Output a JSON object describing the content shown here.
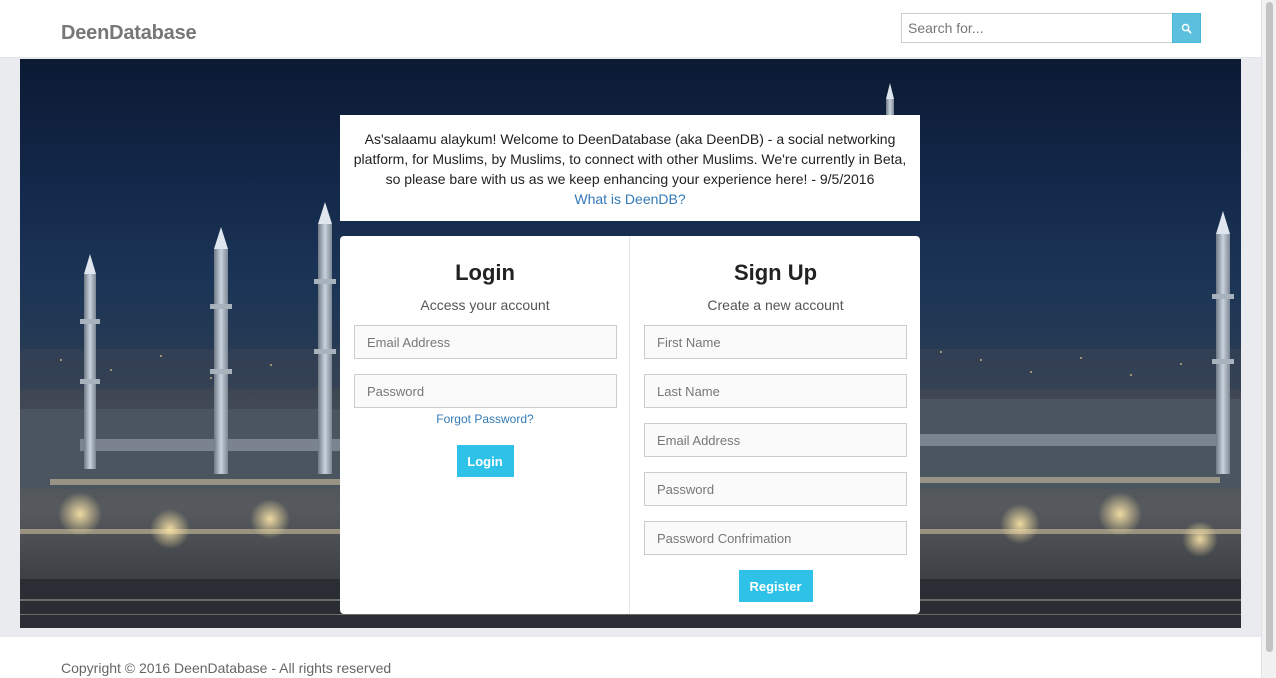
{
  "navbar": {
    "brand": "DeenDatabase",
    "search": {
      "placeholder": "Search for..."
    }
  },
  "welcome": {
    "text": "As'salaamu alaykum! Welcome to DeenDatabase (aka DeenDB) - a social networking platform, for Muslims, by Muslims, to connect with other Muslims. We're currently in Beta, so please bare with us as we keep enhancing your experience here! - 9/5/2016",
    "link": "What is DeenDB?"
  },
  "login": {
    "title": "Login",
    "subtitle": "Access your account",
    "email_placeholder": "Email Address",
    "password_placeholder": "Password",
    "forgot": "Forgot Password?",
    "button": "Login"
  },
  "signup": {
    "title": "Sign Up",
    "subtitle": "Create a new account",
    "first_name_placeholder": "First Name",
    "last_name_placeholder": "Last Name",
    "email_placeholder": "Email Address",
    "password_placeholder": "Password",
    "password_confirm_placeholder": "Password Confrimation",
    "button": "Register"
  },
  "footer": {
    "text": "Copyright © 2016 DeenDatabase - All rights reserved"
  },
  "colors": {
    "accent": "#2fc2e8",
    "search_button": "#5bc0de",
    "link": "#337ab7"
  },
  "icons": {
    "search": "search-icon"
  }
}
